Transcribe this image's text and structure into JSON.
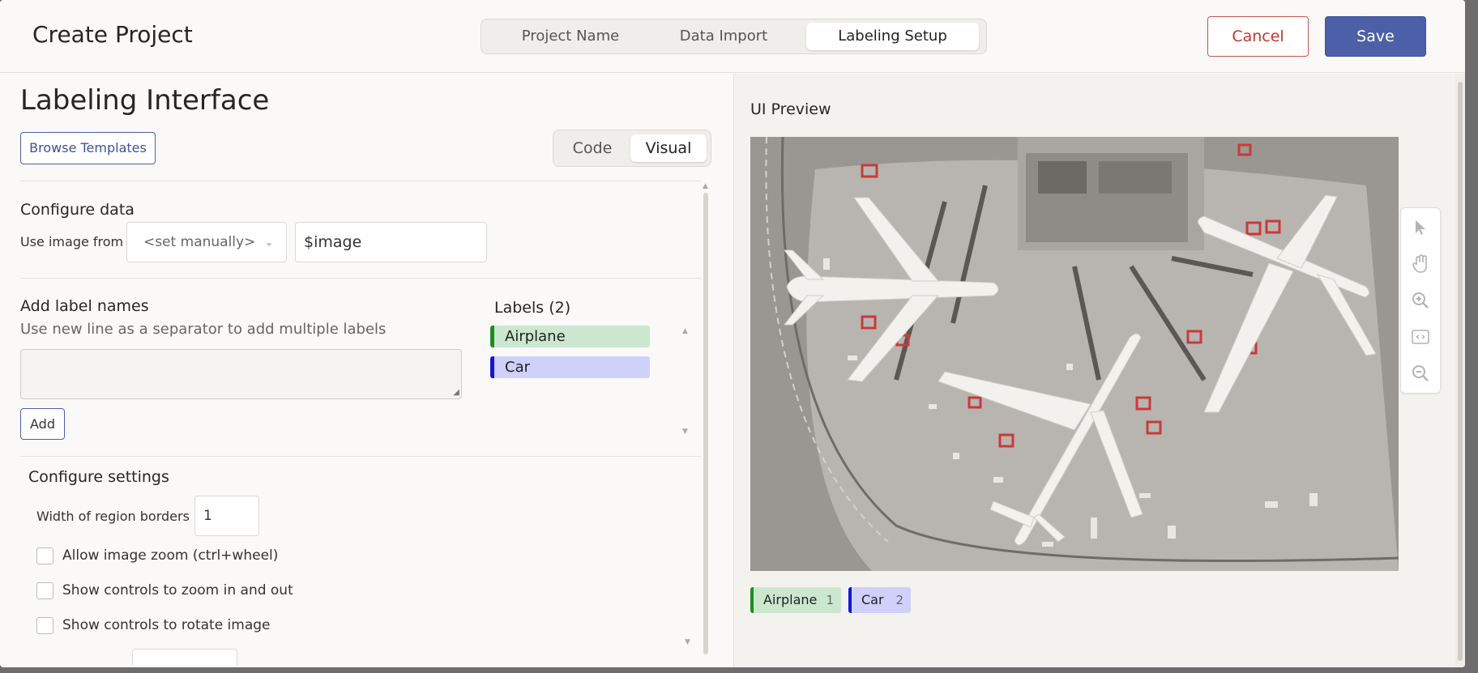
{
  "header": {
    "title": "Create Project",
    "steps": [
      "Project Name",
      "Data Import",
      "Labeling Setup"
    ],
    "active_step": "Labeling Setup",
    "cancel_label": "Cancel",
    "save_label": "Save"
  },
  "left": {
    "title": "Labeling Interface",
    "browse_label": "Browse Templates",
    "modes": [
      "Code",
      "Visual"
    ],
    "active_mode": "Visual",
    "configure_data": {
      "title": "Configure data",
      "use_image_label": "Use image from",
      "select_value": "<set manually>",
      "image_value": "$image"
    },
    "add_labels": {
      "title": "Add label names",
      "hint": "Use new line as a separator to add multiple labels",
      "add_label": "Add",
      "labels_title": "Labels (2)",
      "labels": [
        {
          "name": "Airplane",
          "color": "#1b8f21"
        },
        {
          "name": "Car",
          "color": "#1515d9"
        }
      ]
    },
    "settings": {
      "title": "Configure settings",
      "width_label": "Width of region borders",
      "width_value": "1",
      "checkboxes": [
        "Allow image zoom (ctrl+wheel)",
        "Show controls to zoom in and out",
        "Show controls to rotate image"
      ]
    }
  },
  "preview": {
    "title": "UI Preview",
    "tools": [
      "pointer-icon",
      "hand-icon",
      "zoom-in-icon",
      "fit-icon",
      "zoom-out-icon"
    ],
    "chips": [
      {
        "name": "Airplane",
        "count": "1"
      },
      {
        "name": "Car",
        "count": "2"
      }
    ]
  }
}
